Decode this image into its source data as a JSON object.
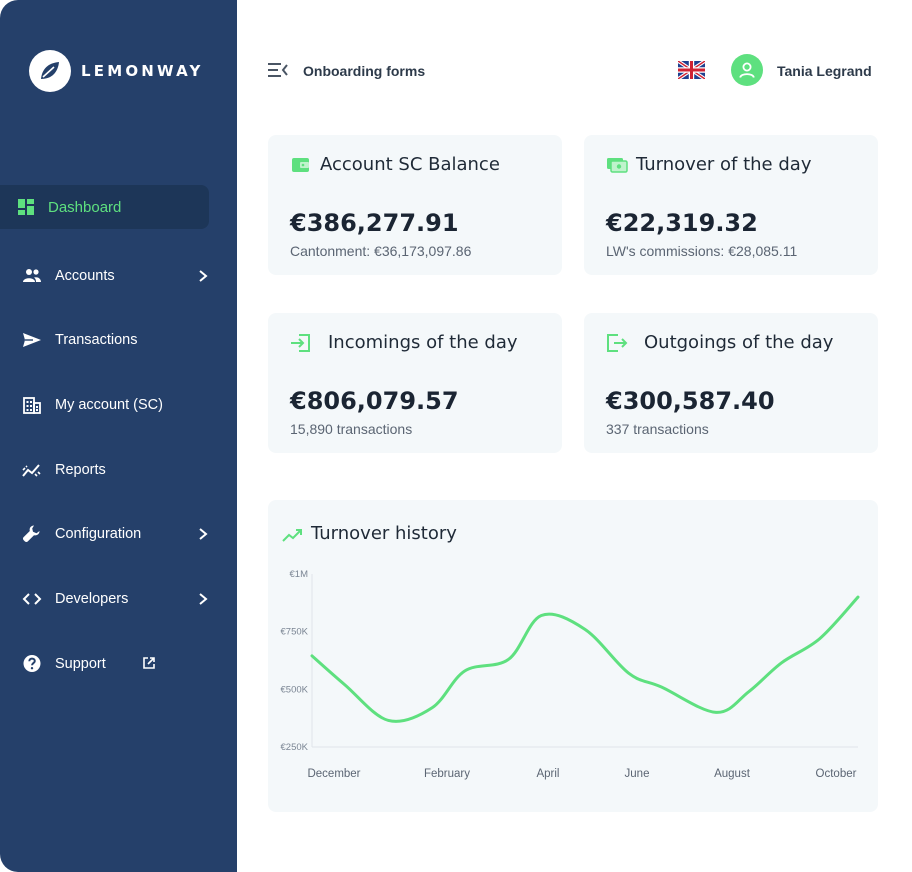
{
  "brand": {
    "name": "LEMONWAY"
  },
  "sidebar": {
    "items": [
      {
        "label": "Dashboard",
        "icon": "dashboard-icon"
      },
      {
        "label": "Accounts",
        "icon": "people-icon"
      },
      {
        "label": "Transactions",
        "icon": "send-icon"
      },
      {
        "label": "My account (SC)",
        "icon": "building-icon"
      },
      {
        "label": "Reports",
        "icon": "trend-icon"
      },
      {
        "label": "Configuration",
        "icon": "wrench-icon"
      },
      {
        "label": "Developers",
        "icon": "code-icon"
      },
      {
        "label": "Support",
        "icon": "help-icon"
      }
    ]
  },
  "header": {
    "title": "Onboarding forms",
    "user_name": "Tania Legrand",
    "language_flag": "uk-flag-icon"
  },
  "colors": {
    "sidebar": "#25406a",
    "accent": "#5ee07f",
    "card_bg": "#f4f8fa"
  },
  "cards": [
    {
      "title": "Account SC Balance",
      "value": "€386,277.91",
      "sub": "Cantonment: €36,173,097.86",
      "icon": "wallet-icon"
    },
    {
      "title": "Turnover of the day",
      "value": "€22,319.32",
      "sub": "LW's commissions: €28,085.11",
      "icon": "cash-icon"
    },
    {
      "title": "Incomings of the day",
      "value": "€806,079.57",
      "sub": "15,890 transactions",
      "icon": "login-icon"
    },
    {
      "title": "Outgoings of the day",
      "value": "€300,587.40",
      "sub": "337 transactions",
      "icon": "logout-icon"
    }
  ],
  "chart_data": {
    "type": "line",
    "title": "Turnover history",
    "x": [
      "December",
      "February",
      "April",
      "June",
      "August",
      "October"
    ],
    "series": [
      {
        "values": [
          645000,
          520000,
          365000,
          420000,
          580000,
          630000,
          820000,
          760000,
          570000,
          510000,
          400000,
          490000,
          615000,
          720000,
          900000
        ]
      }
    ],
    "point_positions": [
      0,
      0.06,
      0.14,
      0.22,
      0.28,
      0.36,
      0.42,
      0.5,
      0.58,
      0.64,
      0.74,
      0.8,
      0.86,
      0.93,
      1.0
    ],
    "y_ticks": [
      "€1M",
      "€750K",
      "€500K",
      "€250K"
    ],
    "ylim": [
      250000,
      1000000
    ],
    "grid": false,
    "color": "#5ee07f"
  }
}
